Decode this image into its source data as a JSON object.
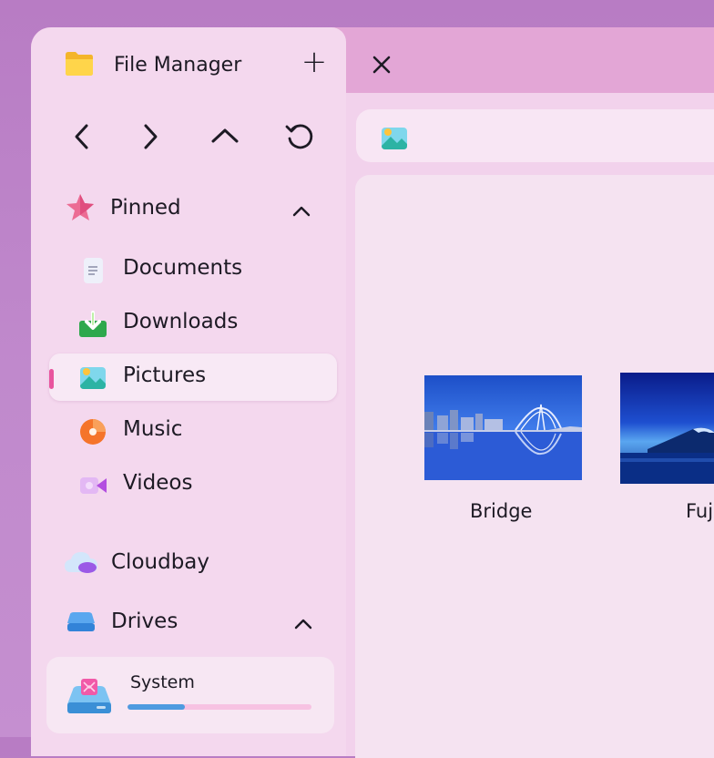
{
  "window": {
    "tab_title": "File Manager",
    "tab_add": "+"
  },
  "toolbar": {
    "back": "back-icon",
    "forward": "forward-icon",
    "up": "up-icon",
    "refresh": "refresh-icon"
  },
  "sidebar": {
    "pinned_label": "Pinned",
    "items": [
      {
        "label": "Documents",
        "icon": "document-icon"
      },
      {
        "label": "Downloads",
        "icon": "download-icon"
      },
      {
        "label": "Pictures",
        "icon": "pictures-icon",
        "active": true
      },
      {
        "label": "Music",
        "icon": "music-icon"
      },
      {
        "label": "Videos",
        "icon": "video-icon"
      }
    ],
    "cloud_label": "Cloudbay",
    "drives_label": "Drives",
    "drives": [
      {
        "name": "System",
        "usage_fraction": 0.31
      }
    ]
  },
  "files": [
    {
      "name": "Bridge"
    },
    {
      "name": "Fuj"
    }
  ],
  "colors": {
    "accent": "#e8549e",
    "drive_fill": "#4e9be0"
  }
}
